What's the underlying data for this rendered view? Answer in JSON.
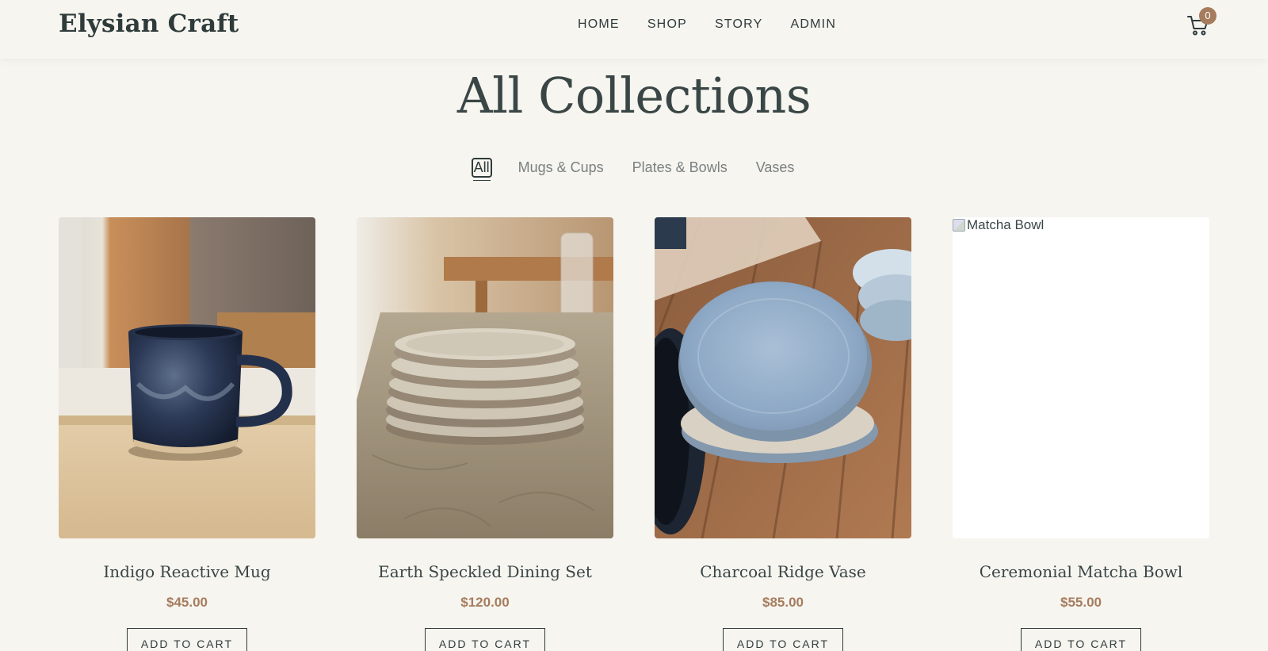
{
  "brand": {
    "name": "Elysian Craft"
  },
  "nav": [
    {
      "label": "HOME"
    },
    {
      "label": "SHOP"
    },
    {
      "label": "STORY"
    },
    {
      "label": "ADMIN"
    }
  ],
  "cart": {
    "count": "0",
    "icon": "cart-icon"
  },
  "page": {
    "title": "All Collections"
  },
  "filters": [
    {
      "label": "All",
      "active": true
    },
    {
      "label": "Mugs & Cups",
      "active": false
    },
    {
      "label": "Plates & Bowls",
      "active": false
    },
    {
      "label": "Vases",
      "active": false
    }
  ],
  "products": [
    {
      "name": "Indigo Reactive Mug",
      "price": "$45.00",
      "button": "ADD TO CART",
      "image": "mug-photo"
    },
    {
      "name": "Earth Speckled Dining Set",
      "price": "$120.00",
      "button": "ADD TO CART",
      "image": "plates-photo"
    },
    {
      "name": "Charcoal Ridge Vase",
      "price": "$85.00",
      "button": "ADD TO CART",
      "image": "blue-plates-photo"
    },
    {
      "name": "Ceremonial Matcha Bowl",
      "price": "$55.00",
      "button": "ADD TO CART",
      "image_alt": "Matcha Bowl",
      "image_broken": true
    }
  ],
  "colors": {
    "background": "#f6f5f0",
    "accent": "#a67c5e",
    "text": "#2f3b3b"
  }
}
